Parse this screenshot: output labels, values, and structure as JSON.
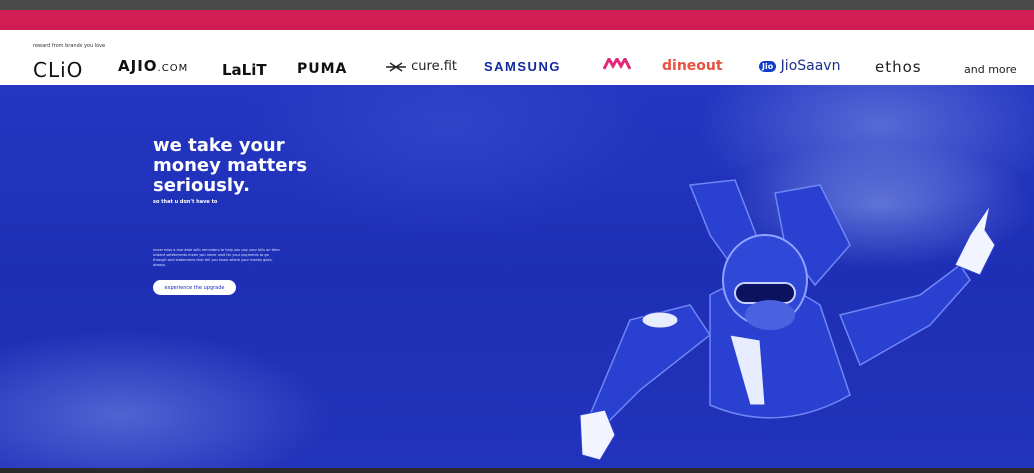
{
  "brands": {
    "caption": "reward from brands you love",
    "logos": {
      "clio": "CLiO",
      "ajio": "AJIO",
      "ajio_suffix": ".COM",
      "lalit": "LaLiT",
      "puma": "PUMA",
      "curefit": "cure.fit",
      "samsung": "SAMSUNG",
      "myntra": "M",
      "dineout": "dineout",
      "saavn_badge": "Jio",
      "saavn": "JioSaavn",
      "ethos": "ethos",
      "more": "and more"
    }
  },
  "hero": {
    "title_line1": "we take your",
    "title_line2": "money matters",
    "title_line3": "seriously.",
    "subtitle": "so that u don't have to",
    "body": "never miss a due date with reminders to help you pay your bills on time. instant settlements mean you never wait for your payments to go through and statements that tell you know where your money goes, always.",
    "cta_label": "experience the upgrade"
  },
  "colors": {
    "hero_blue": "#1f2fb8",
    "brand_band": "#d11d53",
    "cta_bg": "#ffffff"
  }
}
